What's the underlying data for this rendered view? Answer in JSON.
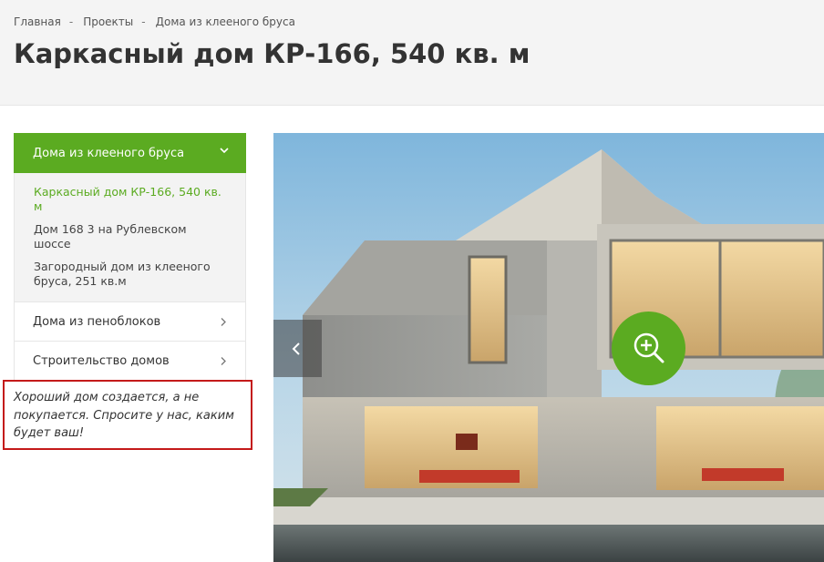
{
  "breadcrumb": {
    "items": [
      "Главная",
      "Проекты",
      "Дома из клееного бруса"
    ],
    "separator": "-"
  },
  "page": {
    "title": "Каркасный дом КР-166, 540 кв. м"
  },
  "sidebar": {
    "active_section": "Дома из клееного бруса",
    "sub_items": [
      "Каркасный дом КР-166, 540 кв. м",
      "Дом 168 3 на Рублевском шоссе",
      "Загородный дом из клееного бруса, 251 кв.м"
    ],
    "sections": [
      "Дома из пеноблоков",
      "Строительство домов"
    ]
  },
  "quote": {
    "text": "Хороший дом создается, а не покупается. Спросите у нас, каким будет ваш!"
  },
  "colors": {
    "accent": "#5bab21",
    "highlight_border": "#c41a1a"
  },
  "icons": {
    "active_section": "chevron-down-icon",
    "sections": "chevron-right-icon",
    "gallery_prev": "chevron-left-icon",
    "gallery_zoom": "zoom-in-icon"
  }
}
